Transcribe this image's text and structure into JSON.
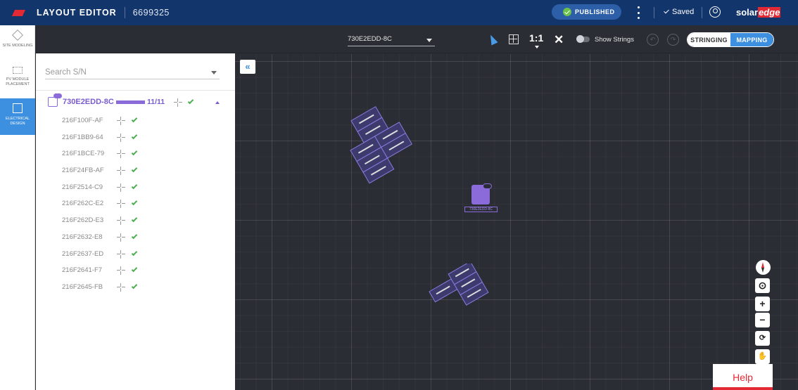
{
  "header": {
    "title": "LAYOUT EDITOR",
    "project_id": "6699325",
    "published_label": "PUBLISHED",
    "saved_label": "Saved",
    "brand_solar": "solar",
    "brand_edge": "edge"
  },
  "rail": {
    "items": [
      {
        "label": "SITE MODELING",
        "icon": "cube-icon",
        "active": false
      },
      {
        "label": "PV MODULE PLACEMENT",
        "icon": "pv-module-icon",
        "active": false
      },
      {
        "label": "ELECTRICAL DESIGN",
        "icon": "electrical-icon",
        "active": true
      }
    ]
  },
  "panel": {
    "search_placeholder": "Search S/N",
    "inverter": {
      "name": "730E2EDD-8C",
      "count": "11/11",
      "progress": 1.0,
      "badge": "04"
    },
    "optimizers": [
      "216F100F-AF",
      "216F1BB9-64",
      "216F1BCE-79",
      "216F24FB-AF",
      "216F2514-C9",
      "216F262C-E2",
      "216F262D-E3",
      "216F2632-E8",
      "216F2637-ED",
      "216F2641-F7",
      "216F2645-FB"
    ]
  },
  "toolbar": {
    "inverter_select": "730E2EDD-8C",
    "scale": "1:1",
    "close": "✕",
    "show_strings": "Show Strings",
    "undo": "↶",
    "redo": "↷",
    "mode_stringing": "STRINGING",
    "mode_mapping": "MAPPING"
  },
  "canvas": {
    "collapse": "«",
    "inverter_label": "730E2EDD-8C",
    "zoom_in": "+",
    "zoom_out": "−",
    "help": "Help"
  },
  "colors": {
    "header_bg": "#12356b",
    "accent_blue": "#3d8fe0",
    "purple": "#8b6bd9",
    "brand_red": "#e32934",
    "check_green": "#4caf50"
  }
}
